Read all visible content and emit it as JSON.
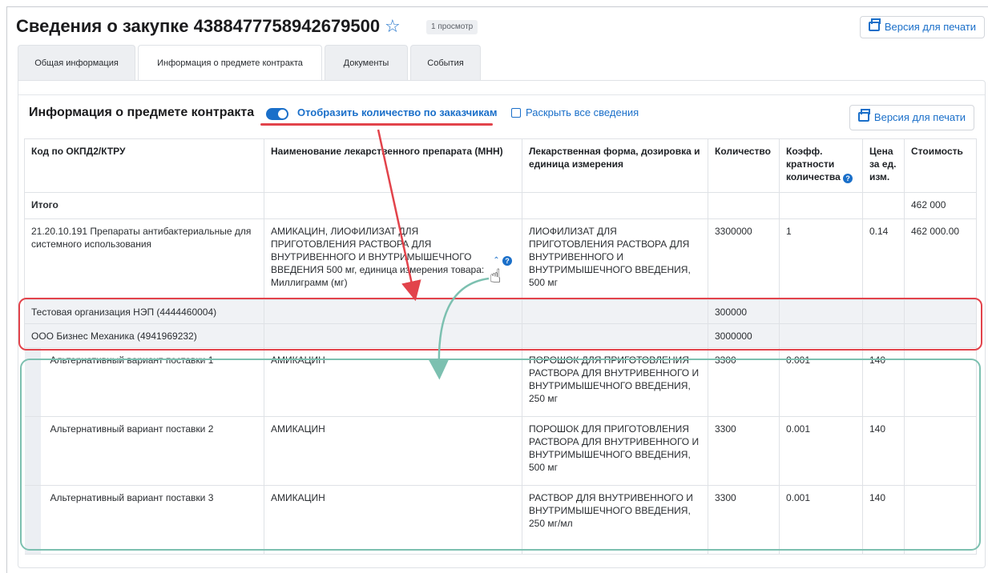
{
  "header": {
    "title": "Сведения о закупке 4388477758942679500",
    "views": "1 просмотр",
    "print_label": "Версия для печати"
  },
  "tabs": [
    {
      "label": "Общая информация",
      "active": false
    },
    {
      "label": "Информация о предмете контракта",
      "active": true
    },
    {
      "label": "Документы",
      "active": false
    },
    {
      "label": "События",
      "active": false
    }
  ],
  "section": {
    "title": "Информация о предмете контракта",
    "toggle_label": "Отобразить количество по заказчикам",
    "toggle_on": true,
    "expand_label": "Раскрыть все сведения",
    "print_label": "Версия для печати"
  },
  "table": {
    "headers": [
      "Код по ОКПД2/КТРУ",
      "Наименование лекарственного препарата (МНН)",
      "Лекарственная форма, дозировка и единица измерения",
      "Количество",
      "Коэфф. кратности количества",
      "Цена за ед. изм.",
      "Стоимость"
    ],
    "total": {
      "label": "Итого",
      "cost": "462 000"
    },
    "main": {
      "code": "21.20.10.191 Препараты антибактериальные для системного использования",
      "name": "АМИКАЦИН, ЛИОФИЛИЗАТ ДЛЯ ПРИГОТОВЛЕНИЯ РАСТВОРА ДЛЯ ВНУТРИВЕННОГО И ВНУТРИМЫШЕЧНОГО ВВЕДЕНИЯ 500 мг, единица измерения товара: Миллиграмм (мг)",
      "form": "ЛИОФИЛИЗАТ ДЛЯ ПРИГОТОВЛЕНИЯ РАСТВОРА ДЛЯ ВНУТРИВЕННОГО И ВНУТРИМЫШЕЧНОГО ВВЕДЕНИЯ, 500 мг",
      "qty": "3300000",
      "coef": "1",
      "price": "0.14",
      "cost": "462 000.00"
    },
    "customers": [
      {
        "name": "Тестовая организация НЭП (4444460004)",
        "qty": "300000"
      },
      {
        "name": "ООО Бизнес Механика (4941969232)",
        "qty": "3000000"
      }
    ],
    "alternatives": [
      {
        "label": "Альтернативный вариант поставки 1",
        "name": "АМИКАЦИН",
        "form": "ПОРОШОК ДЛЯ ПРИГОТОВЛЕНИЯ РАСТВОРА ДЛЯ ВНУТРИВЕННОГО И ВНУТРИМЫШЕЧНОГО ВВЕДЕНИЯ, 250 мг",
        "qty": "3300",
        "coef": "0.001",
        "price": "140"
      },
      {
        "label": "Альтернативный вариант поставки 2",
        "name": "АМИКАЦИН",
        "form": "ПОРОШОК ДЛЯ ПРИГОТОВЛЕНИЯ РАСТВОРА ДЛЯ ВНУТРИВЕННОГО И ВНУТРИМЫШЕЧНОГО ВВЕДЕНИЯ, 500 мг",
        "qty": "3300",
        "coef": "0.001",
        "price": "140"
      },
      {
        "label": "Альтернативный вариант поставки 3",
        "name": "АМИКАЦИН",
        "form": "РАСТВОР ДЛЯ ВНУТРИВЕННОГО И ВНУТРИМЫШЕЧНОГО ВВЕДЕНИЯ, 250 мг/мл",
        "qty": "3300",
        "coef": "0.001",
        "price": "140"
      }
    ]
  },
  "colors": {
    "accent": "#1a6fc9",
    "annotation_red": "#e2434b",
    "annotation_green": "#7cc0b0"
  }
}
